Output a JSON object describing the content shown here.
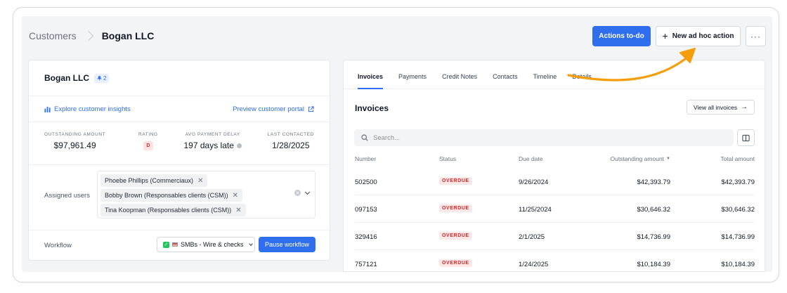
{
  "breadcrumb": {
    "root": "Customers",
    "current": "Bogan LLC"
  },
  "header": {
    "primary_action": "Actions to-do",
    "secondary_action": "New ad hoc action",
    "more": "···"
  },
  "customer": {
    "name": "Bogan LLC",
    "pin_count": "2",
    "insights_link": "Explore customer insights",
    "portal_link": "Preview customer portal",
    "stats": [
      {
        "label": "OUTSTANDING AMOUNT",
        "value": "$97,961.49"
      },
      {
        "label": "RATING",
        "value": "D"
      },
      {
        "label": "AVG PAYMENT DELAY",
        "value": "197 days late"
      },
      {
        "label": "LAST CONTACTED",
        "value": "1/28/2025"
      }
    ],
    "assigned_users_label": "Assigned users",
    "assigned_users": [
      "Phoebe Phillips (Commerciaux)",
      "Bobby Brown (Responsables clients (CSM))",
      "Tina Koopman (Responsables clients (CSM))"
    ],
    "workflow_label": "Workflow",
    "workflow_value": "SMBs - Wire & checks",
    "pause_workflow": "Pause workflow"
  },
  "tabs": [
    "Invoices",
    "Payments",
    "Credit Notes",
    "Contacts",
    "Timeline",
    "Details"
  ],
  "invoices": {
    "title": "Invoices",
    "view_all": "View all invoices",
    "search_placeholder": "Search...",
    "columns": [
      "Number",
      "Status",
      "Due date",
      "Outstanding amount",
      "Total amount"
    ],
    "rows": [
      {
        "number": "502500",
        "status": "OVERDUE",
        "due": "9/26/2024",
        "outstanding": "$42,393.79",
        "total": "$42,393.79"
      },
      {
        "number": "097153",
        "status": "OVERDUE",
        "due": "11/25/2024",
        "outstanding": "$30,646.32",
        "total": "$30,646.32"
      },
      {
        "number": "329416",
        "status": "OVERDUE",
        "due": "2/1/2025",
        "outstanding": "$14,736.99",
        "total": "$14,736.99"
      },
      {
        "number": "757121",
        "status": "OVERDUE",
        "due": "1/24/2025",
        "outstanding": "$10,184.39",
        "total": "$10,184.39"
      }
    ]
  },
  "colors": {
    "accent": "#2f6fed",
    "overdue": "#dc2626",
    "arrow": "#f59e0b"
  }
}
